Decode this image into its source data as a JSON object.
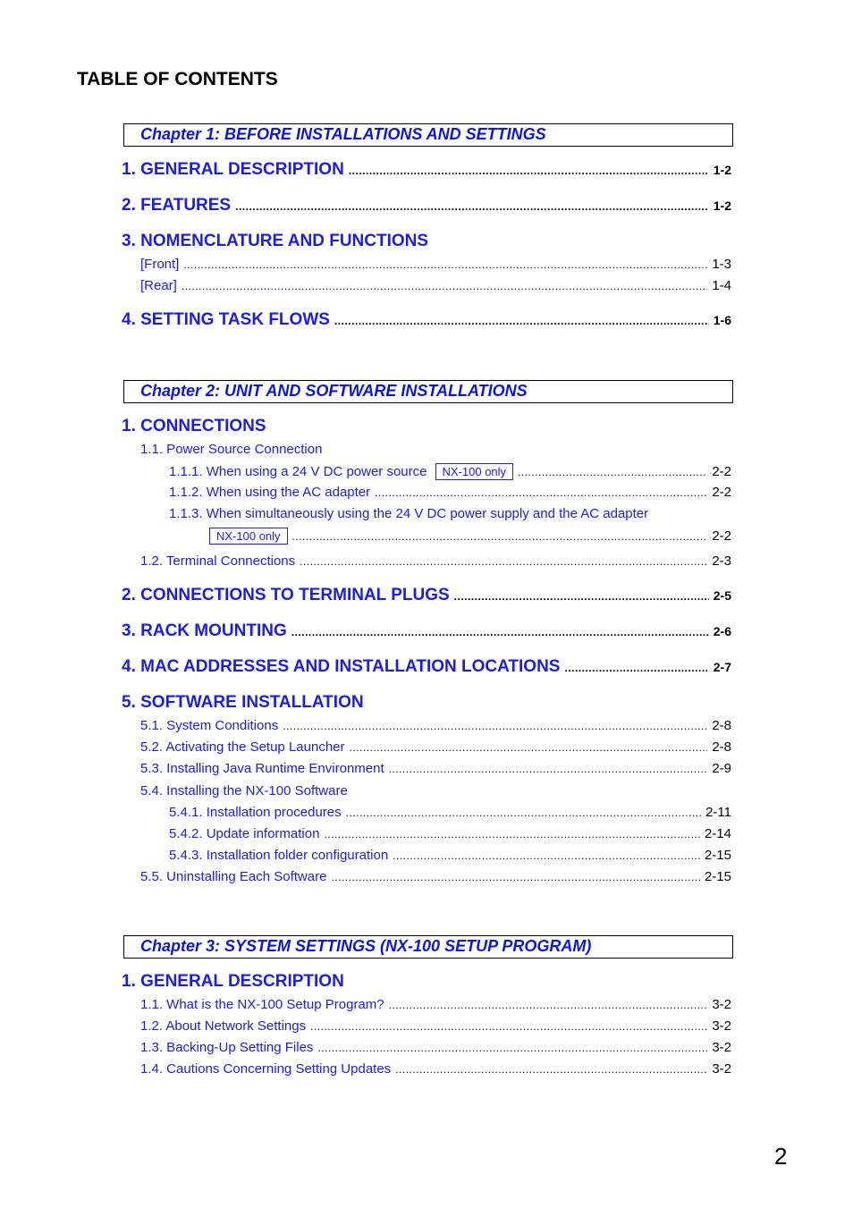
{
  "title": "TABLE OF CONTENTS",
  "page_number": "2",
  "badge": "NX-100 only",
  "chapters": [
    {
      "heading": "Chapter 1: BEFORE INSTALLATIONS AND SETTINGS",
      "entries": [
        {
          "label": "1. GENERAL DESCRIPTION",
          "page": "1-2"
        },
        {
          "label": "2. FEATURES",
          "page": "1-2"
        },
        {
          "label": "3. NOMENCLATURE AND FUNCTIONS",
          "page": ""
        },
        {
          "label": "[Front]",
          "page": "1-3"
        },
        {
          "label": "[Rear]",
          "page": "1-4"
        },
        {
          "label": "4. SETTING TASK FLOWS",
          "page": "1-6"
        }
      ]
    },
    {
      "heading": "Chapter 2: UNIT AND SOFTWARE INSTALLATIONS",
      "entries": [
        {
          "label": "1. CONNECTIONS",
          "page": ""
        },
        {
          "label": "1.1. Power Source Connection",
          "page": ""
        },
        {
          "label": "1.1.1. When using a 24 V DC power source",
          "page": "2-2"
        },
        {
          "label": "1.1.2. When using the AC adapter",
          "page": "2-2"
        },
        {
          "label": "1.1.3. When simultaneously using the 24 V DC power supply and the AC adapter",
          "page": "2-2"
        },
        {
          "label": "1.2. Terminal Connections",
          "page": "2-3"
        },
        {
          "label": "2. CONNECTIONS TO TERMINAL PLUGS",
          "page": "2-5"
        },
        {
          "label": "3. RACK MOUNTING",
          "page": "2-6"
        },
        {
          "label": "4. MAC ADDRESSES AND INSTALLATION LOCATIONS",
          "page": "2-7"
        },
        {
          "label": "5. SOFTWARE INSTALLATION",
          "page": ""
        },
        {
          "label": "5.1. System Conditions",
          "page": "2-8"
        },
        {
          "label": "5.2. Activating the Setup Launcher",
          "page": "2-8"
        },
        {
          "label": "5.3. Installing Java Runtime Environment",
          "page": "2-9"
        },
        {
          "label": "5.4. Installing the NX-100 Software",
          "page": ""
        },
        {
          "label": "5.4.1. Installation procedures",
          "page": "2-11"
        },
        {
          "label": "5.4.2. Update information",
          "page": "2-14"
        },
        {
          "label": "5.4.3. Installation folder configuration",
          "page": "2-15"
        },
        {
          "label": "5.5. Uninstalling Each Software",
          "page": "2-15"
        }
      ]
    },
    {
      "heading": "Chapter 3: SYSTEM SETTINGS (NX-100 SETUP PROGRAM)",
      "entries": [
        {
          "label": "1. GENERAL DESCRIPTION",
          "page": ""
        },
        {
          "label": "1.1. What is the NX-100 Setup Program?",
          "page": "3-2"
        },
        {
          "label": "1.2. About Network Settings",
          "page": "3-2"
        },
        {
          "label": "1.3. Backing-Up Setting Files",
          "page": "3-2"
        },
        {
          "label": "1.4. Cautions Concerning Setting Updates",
          "page": "3-2"
        }
      ]
    }
  ]
}
